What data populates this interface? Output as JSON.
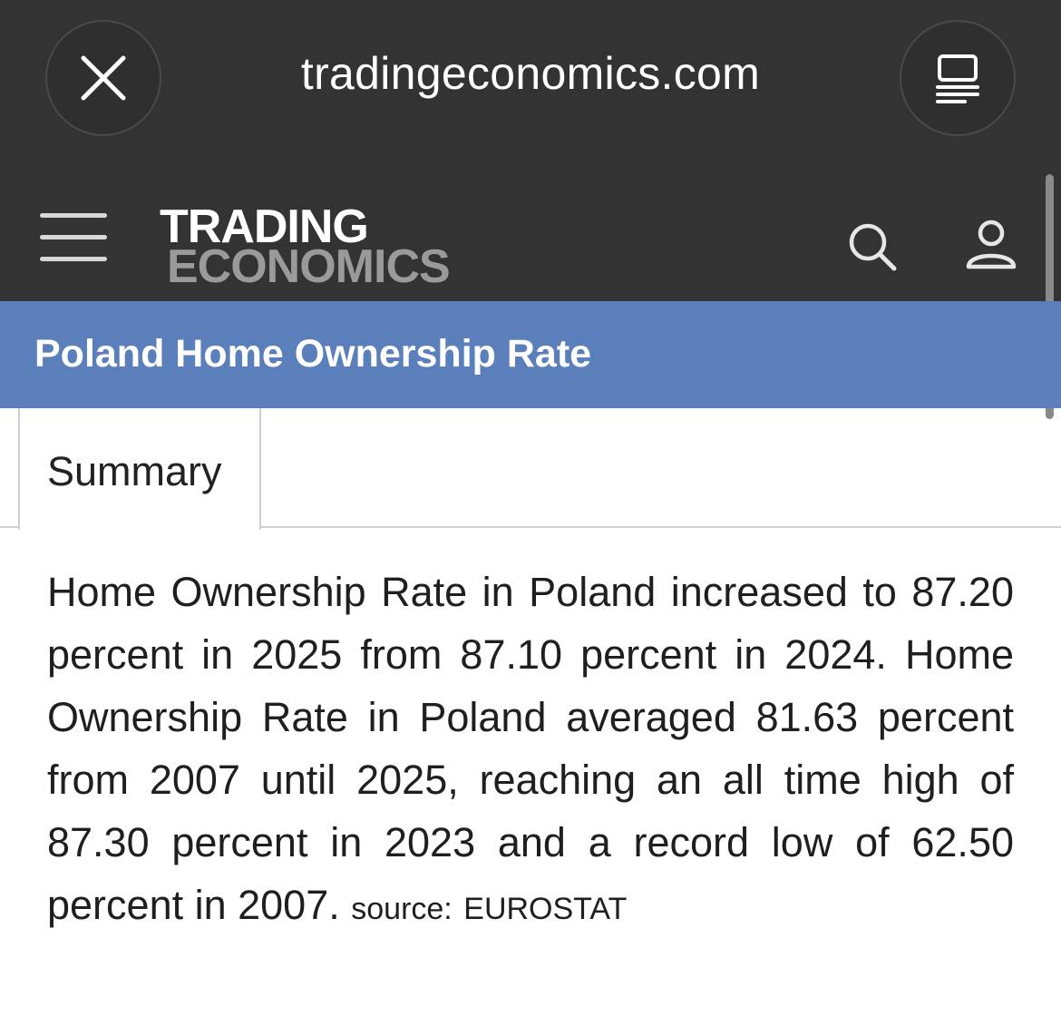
{
  "browser": {
    "url": "tradingeconomics.com",
    "close_icon": "close-icon",
    "reader_icon": "reader-mode-icon"
  },
  "header": {
    "logo_line1": "TRADING",
    "logo_line2": "ECONOMICS",
    "menu_icon": "hamburger-menu-icon",
    "search_icon": "search-icon",
    "user_icon": "user-icon"
  },
  "page": {
    "title": "Poland Home Ownership Rate"
  },
  "tabs": [
    {
      "label": "Summary",
      "active": true
    }
  ],
  "summary": {
    "text": "Home Ownership Rate in Poland increased to 87.20 percent in 2025 from 87.10 percent in 2024. Home Ownership Rate in Poland averaged 81.63 percent from 2007 until 2025, reaching an all time high of 87.30 percent in 2023 and a record low of 62.50 percent in 2007.",
    "source_label": "source:",
    "source_value": "EUROSTAT"
  },
  "colors": {
    "chrome_bg": "#333333",
    "title_band": "#5b7fbb",
    "logo_secondary": "#9a9a9a",
    "text": "#1f1f1f"
  }
}
